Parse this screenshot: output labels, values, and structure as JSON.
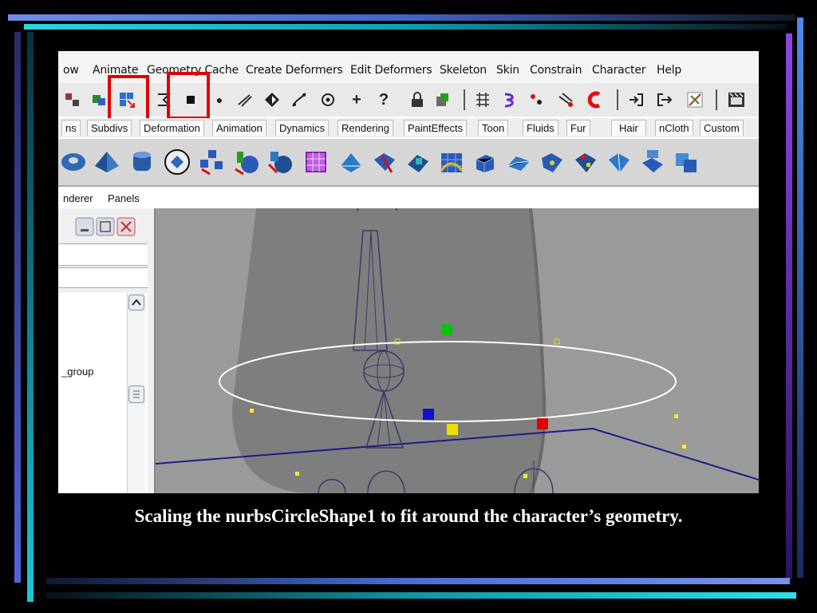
{
  "menubar": {
    "items": [
      "ow",
      "Animate",
      "Geometry Cache",
      "Create Deformers",
      "Edit Deformers",
      "Skeleton",
      "Skin",
      "Constrain",
      "Character",
      "Help"
    ]
  },
  "shelf_tabs": [
    "ns",
    "Subdivs",
    "Deformation",
    "Animation",
    "Dynamics",
    "Rendering",
    "PaintEffects",
    "Toon",
    "Fluids",
    "Fur",
    "Hair",
    "nCloth",
    "Custom"
  ],
  "panel_menu": {
    "renderer": "nderer",
    "panels": "Panels"
  },
  "outliner": {
    "item_label": "_group"
  },
  "toolbar_glyphs": [
    "●",
    "+",
    "?"
  ],
  "caption": "Scaling the nurbsCircleShape1 to fit around the character’s geometry.",
  "colors": {
    "highlight_box": "#e00000",
    "viewport_bg": "#9a9a9a",
    "slide_bg": "#000000",
    "accent_cyan": "#18c8d8",
    "accent_blue": "#5a7ee0"
  }
}
